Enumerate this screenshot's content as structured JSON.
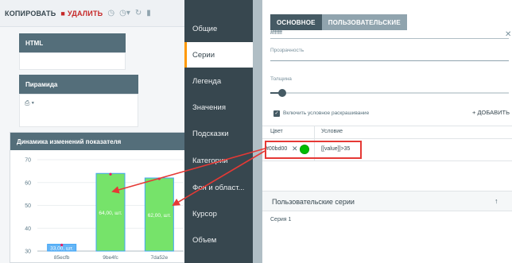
{
  "toolbar": {
    "copy_label": "КОПИРОВАТЬ",
    "delete_label": "УДАЛИТЬ"
  },
  "panels": {
    "html_title": "HTML",
    "pyramid_title": "Пирамида",
    "chart_title": "Динамика изменений показателя"
  },
  "menu": {
    "items": [
      {
        "label": "Общие"
      },
      {
        "label": "Серии"
      },
      {
        "label": "Легенда"
      },
      {
        "label": "Значения"
      },
      {
        "label": "Подсказки"
      },
      {
        "label": "Категории"
      },
      {
        "label": "Фон и област..."
      },
      {
        "label": "Курсор"
      },
      {
        "label": "Объем"
      }
    ],
    "active_index": 1
  },
  "settings": {
    "tabs": [
      {
        "label": "ОСНОВНОЕ",
        "active": true
      },
      {
        "label": "ПОЛЬЗОВАТЕЛЬСКИЕ",
        "active": false
      }
    ],
    "color_value": "#ffffff",
    "opacity_label": "Прозрачность",
    "thickness_label": "Толщина",
    "conditional_label": "Включить условное раскрашивание",
    "add_label": "+ ДОБАВИТЬ",
    "table": {
      "color_header": "Цвет",
      "condition_header": "Условие",
      "row_color": "#00bd00",
      "row_condition": "[[value]]>35"
    },
    "custom_series_title": "Пользовательские серии",
    "series_items": [
      "Серия 1"
    ]
  },
  "colors": {
    "highlight": "#e53935",
    "condition_color": "#00bd00",
    "panel_header": "#546e7a",
    "menu_bg": "#37474f"
  },
  "chart_data": {
    "type": "bar",
    "categories": [
      "85ecfb",
      "9be4fc",
      "7da52e"
    ],
    "values": [
      33,
      64,
      62
    ],
    "data_labels": [
      "33,00, шт.",
      "64,00, шт.",
      "62,00, шт."
    ],
    "bar_colors": [
      "#64b5f6",
      "#76e36a",
      "#76e36a"
    ],
    "yticks": [
      30,
      40,
      50,
      60,
      70
    ],
    "ylim": [
      30,
      70
    ],
    "title": "Динамика изменений показателя"
  }
}
